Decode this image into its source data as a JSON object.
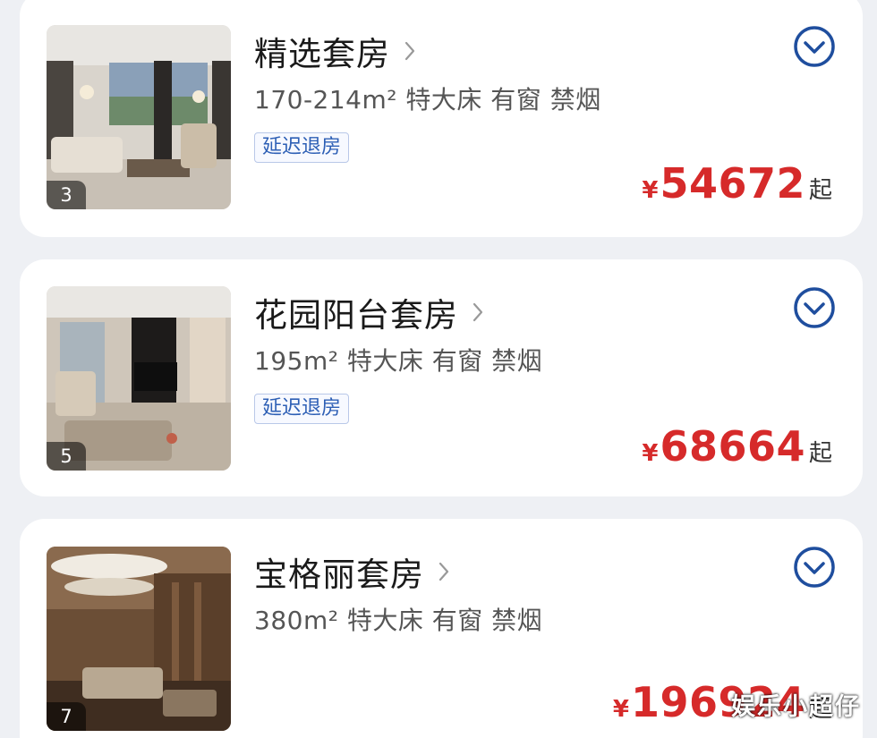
{
  "accent_color": "#d62a2a",
  "icon_color": "#1f4e9e",
  "rooms": [
    {
      "name": "精选套房",
      "desc": "170-214m² 特大床 有窗 禁烟",
      "tag": "延迟退房",
      "photo_count": "3",
      "currency": "¥",
      "price": "54672",
      "price_suffix": "起"
    },
    {
      "name": "花园阳台套房",
      "desc": "195m² 特大床 有窗 禁烟",
      "tag": "延迟退房",
      "photo_count": "5",
      "currency": "¥",
      "price": "68664",
      "price_suffix": "起"
    },
    {
      "name": "宝格丽套房",
      "desc": "380m² 特大床 有窗 禁烟",
      "photo_count": "7",
      "currency": "¥",
      "price": "196924",
      "price_suffix": "起"
    }
  ],
  "watermark": "娱乐小超仔"
}
